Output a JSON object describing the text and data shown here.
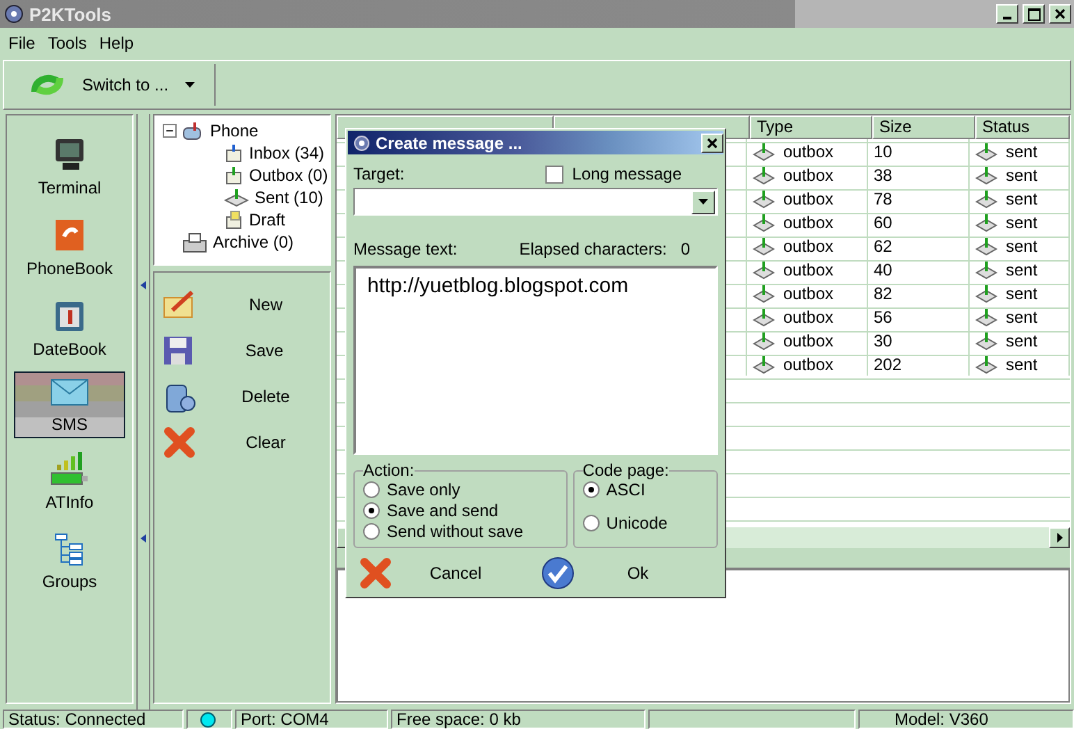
{
  "window": {
    "title": "P2KTools"
  },
  "menu": [
    "File",
    "Tools",
    "Help"
  ],
  "toolbar": {
    "switch_label": "Switch to ..."
  },
  "sidebar": {
    "items": [
      {
        "label": "Terminal",
        "kind": "terminal",
        "selected": false
      },
      {
        "label": "PhoneBook",
        "kind": "phonebook",
        "selected": false
      },
      {
        "label": "DateBook",
        "kind": "datebook",
        "selected": false
      },
      {
        "label": "SMS",
        "kind": "sms",
        "selected": true
      },
      {
        "label": "ATInfo",
        "kind": "atinfo",
        "selected": false
      },
      {
        "label": "Groups",
        "kind": "groups",
        "selected": false
      }
    ]
  },
  "folders": [
    {
      "label": "Phone",
      "kind": "phone",
      "expanded": true,
      "children": [
        {
          "label": "Inbox (34)",
          "kind": "inbox"
        },
        {
          "label": "Outbox (0)",
          "kind": "outbox"
        },
        {
          "label": "Sent (10)",
          "kind": "sent"
        },
        {
          "label": "Draft",
          "kind": "draft"
        }
      ]
    },
    {
      "label": "Archive (0)",
      "kind": "archive"
    }
  ],
  "actions": [
    {
      "label": "New",
      "kind": "new"
    },
    {
      "label": "Save",
      "kind": "save"
    },
    {
      "label": "Delete",
      "kind": "delete"
    },
    {
      "label": "Clear",
      "kind": "clear"
    }
  ],
  "table": {
    "columns": [
      "Type",
      "Size",
      "Status"
    ],
    "rows": [
      {
        "type": "outbox",
        "size": "10",
        "status": "sent"
      },
      {
        "type": "outbox",
        "size": "38",
        "status": "sent"
      },
      {
        "type": "outbox",
        "size": "78",
        "status": "sent"
      },
      {
        "type": "outbox",
        "size": "60",
        "status": "sent"
      },
      {
        "type": "outbox",
        "size": "62",
        "status": "sent"
      },
      {
        "type": "outbox",
        "size": "40",
        "status": "sent"
      },
      {
        "type": "outbox",
        "size": "82",
        "status": "sent"
      },
      {
        "type": "outbox",
        "size": "56",
        "status": "sent"
      },
      {
        "type": "outbox",
        "size": "30",
        "status": "sent"
      },
      {
        "type": "outbox",
        "size": "202",
        "status": "sent"
      }
    ]
  },
  "dialog": {
    "title": "Create message ...",
    "target_label": "Target:",
    "long_message": {
      "label": "Long message",
      "checked": false
    },
    "message_label": "Message text:",
    "elapsed_label": "Elapsed characters:",
    "elapsed": "0",
    "message": "http://yuetblog.blogspot.com",
    "action": {
      "legend": "Action:",
      "options": [
        {
          "label": "Save only",
          "selected": false
        },
        {
          "label": "Save and send",
          "selected": true
        },
        {
          "label": "Send without save",
          "selected": false
        }
      ]
    },
    "code_page": {
      "legend": "Code page:",
      "options": [
        {
          "label": "ASCI",
          "selected": true
        },
        {
          "label": "Unicode",
          "selected": false
        }
      ]
    },
    "cancel": "Cancel",
    "ok": "Ok"
  },
  "status_bar": {
    "status": "Status: Connected",
    "port": "Port: COM4",
    "free_space": "Free space: 0 kb",
    "model": "Model: V360"
  }
}
